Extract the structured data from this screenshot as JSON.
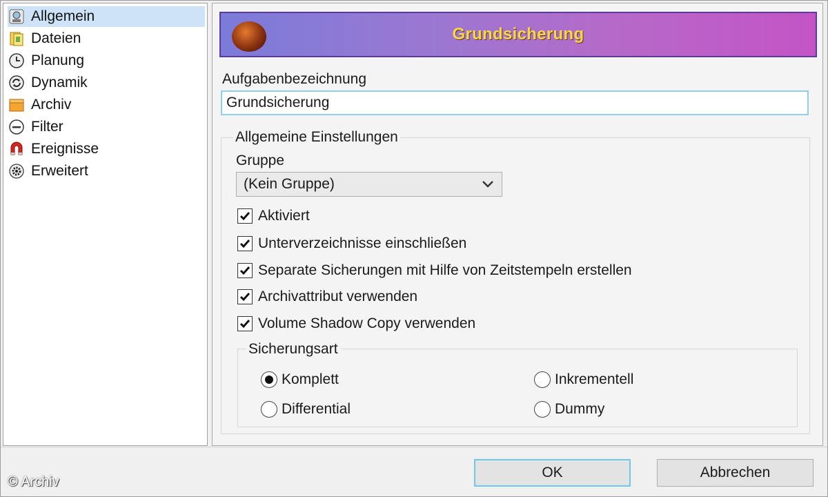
{
  "sidebar": {
    "items": [
      {
        "label": "Allgemein",
        "icon": "user-settings-icon",
        "selected": true
      },
      {
        "label": "Dateien",
        "icon": "files-icon"
      },
      {
        "label": "Planung",
        "icon": "clock-icon"
      },
      {
        "label": "Dynamik",
        "icon": "refresh-icon"
      },
      {
        "label": "Archiv",
        "icon": "archive-folder-icon"
      },
      {
        "label": "Filter",
        "icon": "filter-minus-icon"
      },
      {
        "label": "Ereignisse",
        "icon": "magnet-icon"
      },
      {
        "label": "Erweitert",
        "icon": "gear-icon"
      }
    ]
  },
  "banner": {
    "title": "Grundsicherung"
  },
  "task": {
    "label": "Aufgabenbezeichnung",
    "value": "Grundsicherung"
  },
  "general": {
    "title": "Allgemeine Einstellungen",
    "group_label": "Gruppe",
    "group_value": "(Kein Gruppe)",
    "checkboxes": [
      {
        "label": "Aktiviert",
        "checked": true
      },
      {
        "label": "Unterverzeichnisse einschließen",
        "checked": true
      },
      {
        "label": "Separate Sicherungen mit Hilfe von Zeitstempeln erstellen",
        "checked": true
      },
      {
        "label": "Archivattribut verwenden",
        "checked": true
      },
      {
        "label": "Volume Shadow Copy verwenden",
        "checked": true
      }
    ]
  },
  "backup_type": {
    "title": "Sicherungsart",
    "options": [
      {
        "label": "Komplett",
        "selected": true
      },
      {
        "label": "Inkrementell",
        "selected": false
      },
      {
        "label": "Differential",
        "selected": false
      },
      {
        "label": "Dummy",
        "selected": false
      }
    ]
  },
  "buttons": {
    "ok": "OK",
    "cancel": "Abbrechen"
  },
  "watermark": "© Archiv",
  "colors": {
    "banner_title": "#f7d64a",
    "selection": "#cfe3f8",
    "focus_border": "#8fd0e8"
  }
}
